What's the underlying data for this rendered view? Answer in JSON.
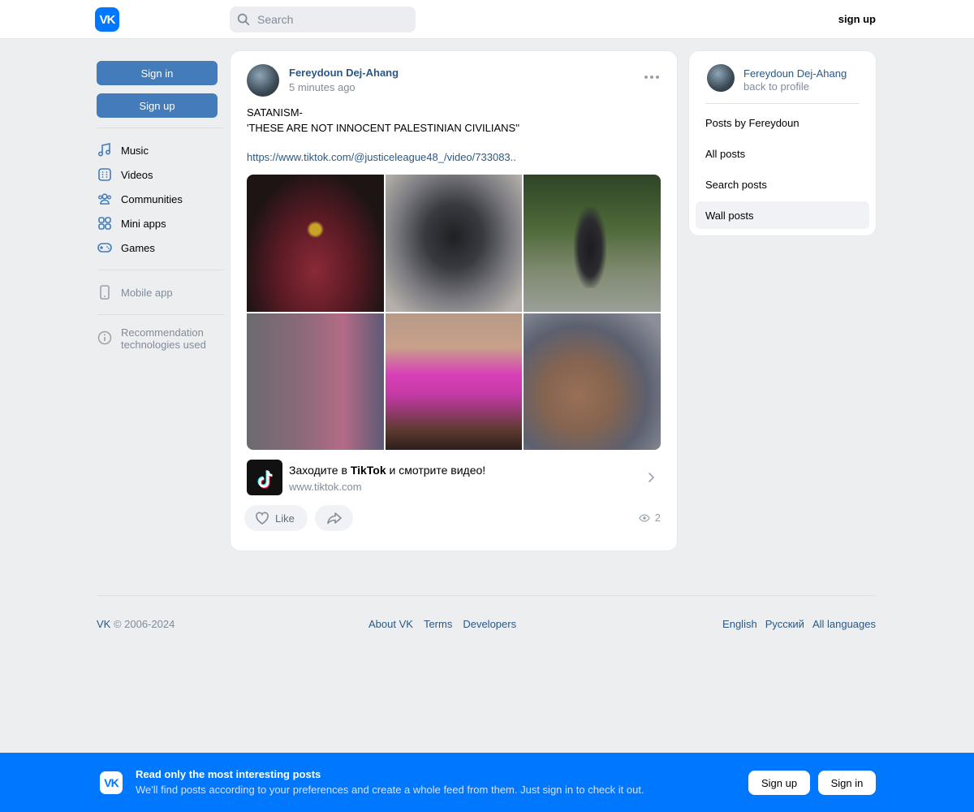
{
  "header": {
    "logo": "VK",
    "search_placeholder": "Search",
    "signup_link": "sign up"
  },
  "sidebar": {
    "signin_label": "Sign in",
    "signup_label": "Sign up",
    "items": [
      {
        "label": "Music",
        "icon": "music-icon"
      },
      {
        "label": "Videos",
        "icon": "video-icon"
      },
      {
        "label": "Communities",
        "icon": "communities-icon"
      },
      {
        "label": "Mini apps",
        "icon": "mini-apps-icon"
      },
      {
        "label": "Games",
        "icon": "gamepad-icon"
      }
    ],
    "mobile_app": "Mobile app",
    "recommendation": "Recommendation technologies used"
  },
  "post": {
    "author": "Fereydoun Dej-Ahang",
    "time": "5 minutes ago",
    "text_line1": "SATANISM-",
    "text_line2": "'THESE ARE NOT INNOCENT PALESTINIAN CIVILIANS''",
    "link": "https://www.tiktok.com/@justiceleague48_/video/733083..",
    "snippet": {
      "title_before": "Заходите в ",
      "title_brand": "TikTok",
      "title_after": " и смотрите видео!",
      "domain": "www.tiktok.com"
    },
    "like_label": "Like",
    "views": "2"
  },
  "profile_card": {
    "name": "Fereydoun Dej-Ahang",
    "back": "back to profile",
    "items": [
      {
        "label": "Posts by Fereydoun"
      },
      {
        "label": "All posts"
      },
      {
        "label": "Search posts"
      },
      {
        "label": "Wall posts"
      }
    ]
  },
  "footer": {
    "vk": "VK",
    "copyright": " © 2006-2024",
    "links": [
      "About VK",
      "Terms",
      "Developers"
    ],
    "languages": [
      "English",
      "Русский",
      "All languages"
    ]
  },
  "banner": {
    "logo": "VK",
    "title": "Read only the most interesting posts",
    "subtitle": "We'll find posts according to your preferences and create a whole feed from them. Just sign in to check it out.",
    "signup": "Sign up",
    "signin": "Sign in"
  },
  "colors": {
    "accent": "#0077ff",
    "button": "#447bba",
    "link": "#2a5885",
    "background": "#edeef0"
  }
}
